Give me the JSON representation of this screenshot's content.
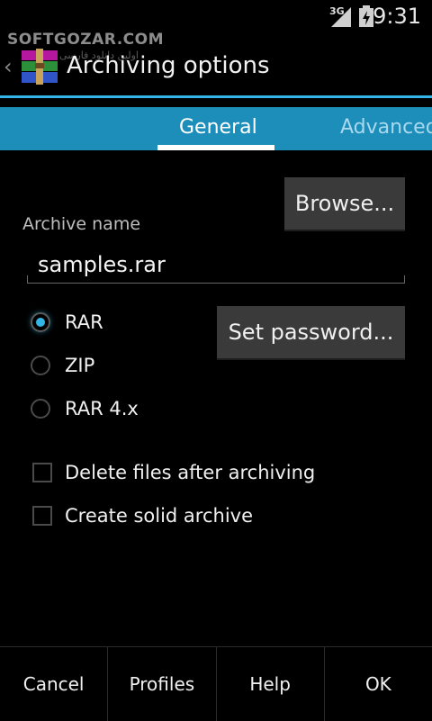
{
  "status_bar": {
    "network": "3G",
    "clock": "9:31",
    "signal_icon": "signal-icon",
    "battery_icon": "battery-icon"
  },
  "watermark": {
    "text": "SOFTGOZAR.COM",
    "subtext": "اولین دانلود فارسی"
  },
  "action_bar": {
    "title": "Archiving options",
    "app_icon": "winrar-icon"
  },
  "tabs": [
    {
      "label": "General",
      "selected": true
    },
    {
      "label": "Advanced",
      "selected": false
    }
  ],
  "form": {
    "browse_label": "Browse...",
    "archive_name_label": "Archive name",
    "archive_name_value": "samples.rar",
    "set_password_label": "Set password...",
    "formats": [
      {
        "label": "RAR",
        "checked": true
      },
      {
        "label": "ZIP",
        "checked": false
      },
      {
        "label": "RAR 4.x",
        "checked": false
      }
    ],
    "options": [
      {
        "label": "Delete files after archiving",
        "checked": false
      },
      {
        "label": "Create solid archive",
        "checked": false
      }
    ]
  },
  "bottom_bar": {
    "cancel": "Cancel",
    "profiles": "Profiles",
    "help": "Help",
    "ok": "OK"
  },
  "colors": {
    "accent": "#33b5e5",
    "tab_bar": "#1d8dba",
    "button": "#3a3a3a"
  }
}
